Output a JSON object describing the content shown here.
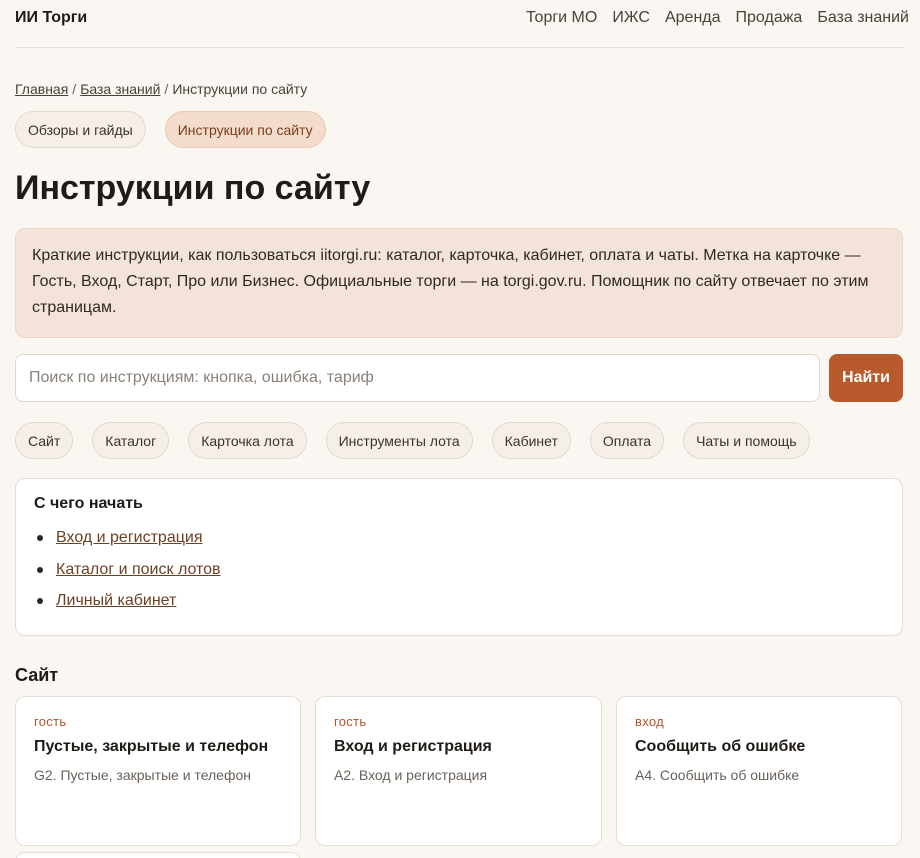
{
  "header": {
    "brand": "ИИ Торги",
    "nav": [
      "Торги МО",
      "ИЖС",
      "Аренда",
      "Продажа",
      "База знаний"
    ]
  },
  "breadcrumb": {
    "home": "Главная",
    "kb": "База знаний",
    "current": "Инструкции по сайту",
    "sep": "/"
  },
  "section_tabs": [
    "Обзоры и гайды",
    "Инструкции по сайту"
  ],
  "page_title": "Инструкции по сайту",
  "intro": "Краткие инструкции, как пользоваться iitorgi.ru: каталог, карточка, кабинет, оплата и чаты. Метка на карточке — Гость, Вход, Старт, Про или Бизнес. Официальные торги — на torgi.gov.ru. Помощник по сайту отвечает по этим страницам.",
  "search": {
    "placeholder": "Поиск по инструкциям: кнопка, ошибка, тариф",
    "button": "Найти"
  },
  "filters": [
    "Сайт",
    "Каталог",
    "Карточка лота",
    "Инструменты лота",
    "Кабинет",
    "Оплата",
    "Чаты и помощь"
  ],
  "start": {
    "title": "С чего начать",
    "links": [
      "Вход и регистрация",
      "Каталог и поиск лотов",
      "Личный кабинет"
    ]
  },
  "section": {
    "title": "Сайт",
    "cards": [
      {
        "tag": "гость",
        "title": "Пустые, закрытые и телефон",
        "sub": "G2. Пустые, закрытые и телефон"
      },
      {
        "tag": "гость",
        "title": "Вход и регистрация",
        "sub": "A2. Вход и регистрация"
      },
      {
        "tag": "вход",
        "title": "Сообщить об ошибке",
        "sub": "A4. Сообщить об ошибке"
      }
    ]
  }
}
